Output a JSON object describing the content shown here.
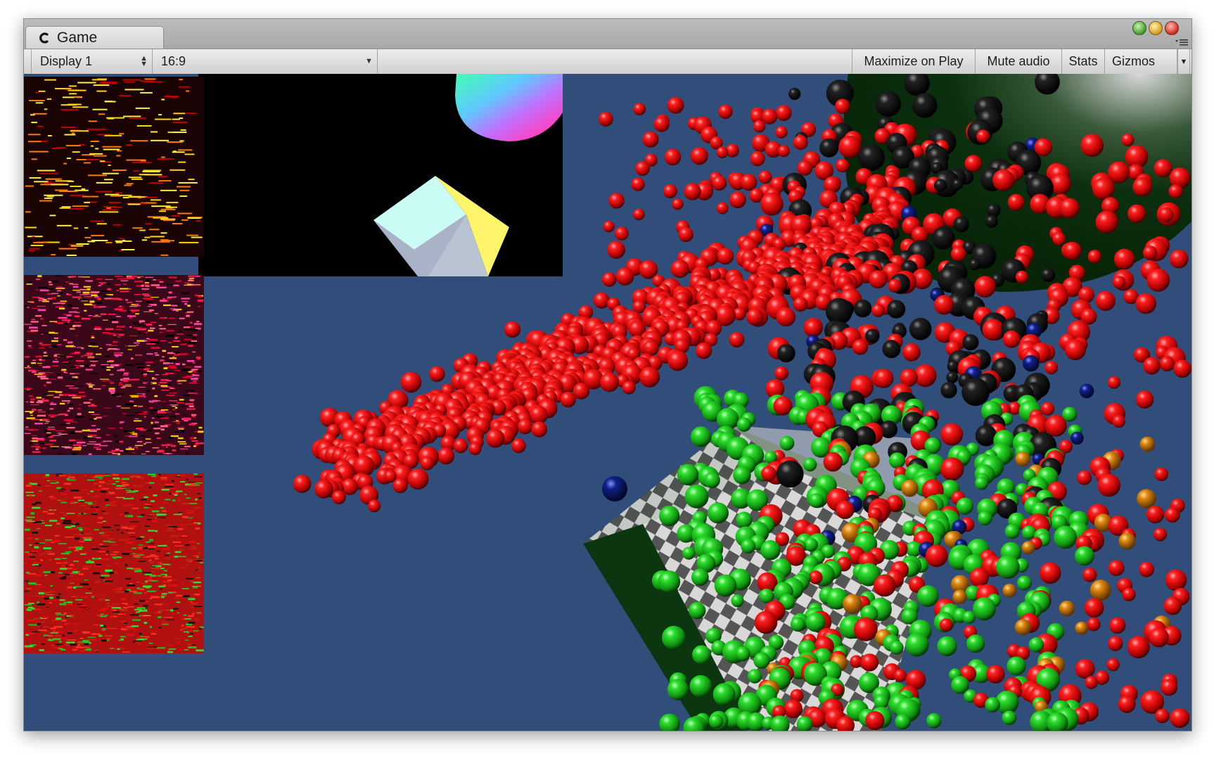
{
  "window": {
    "tab_label": "Game",
    "tab_icon": "unity-logo-icon",
    "traffic_lights": [
      "green",
      "yellow",
      "red"
    ]
  },
  "toolbar": {
    "display_label": "Display 1",
    "aspect_label": "16:9",
    "maximize_label": "Maximize on Play",
    "mute_label": "Mute audio",
    "stats_label": "Stats",
    "gizmos_label": "Gizmos"
  },
  "scene": {
    "background_color": "#314d7a",
    "sphere_colors": [
      "#d41414",
      "#1fb81f",
      "#111111",
      "#d97a00",
      "#0a1a6a"
    ],
    "texture_previews": [
      "noise-yellow-red",
      "noise-red-pink",
      "noise-red-green"
    ],
    "objects": [
      "rainbow-sphere",
      "white-yellow-cube",
      "dark-green-sphere",
      "checkered-box",
      "particle-spheres"
    ]
  }
}
